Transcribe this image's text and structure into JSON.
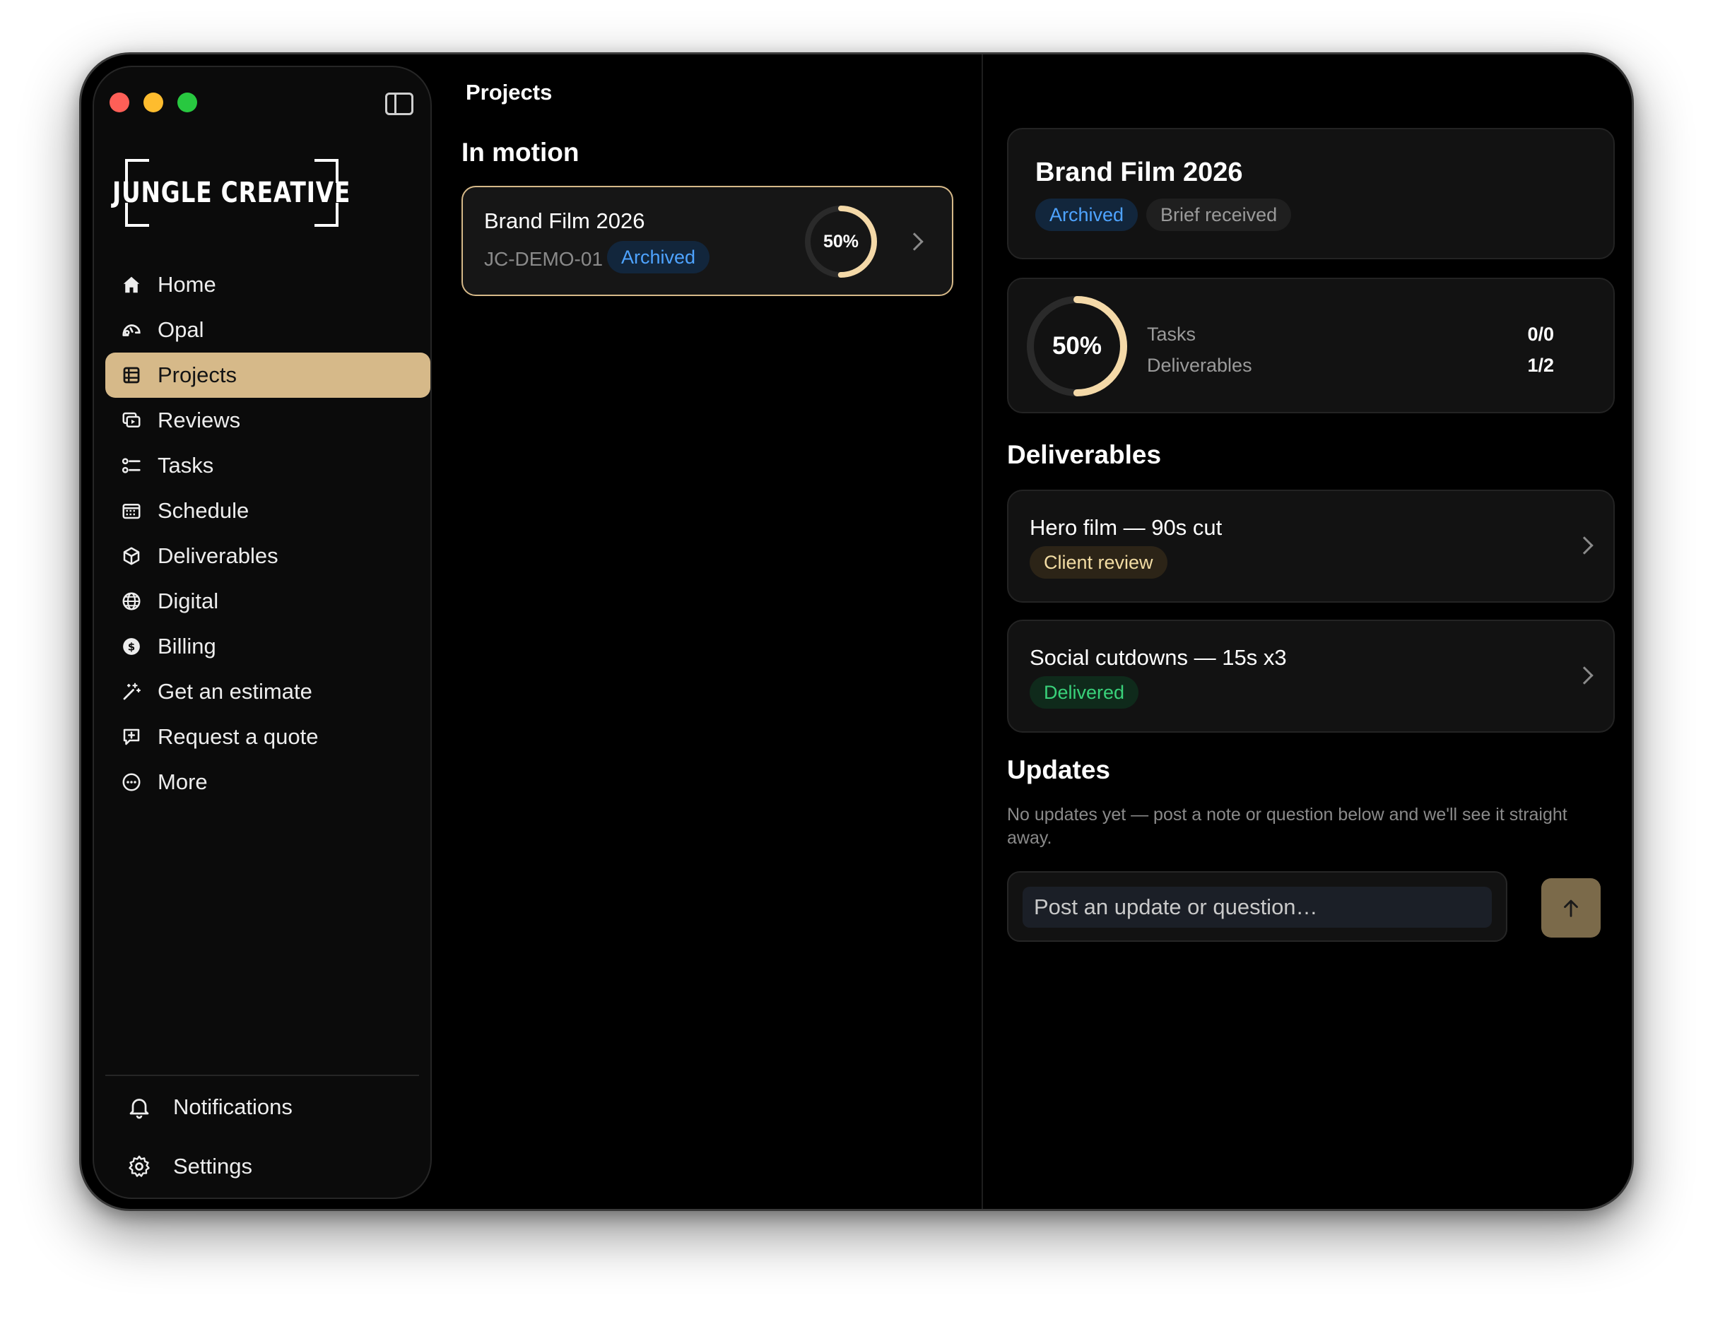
{
  "brand": {
    "logo_text": "JUNGLE CREATIVE"
  },
  "sidebar": {
    "items": [
      {
        "label": "Home",
        "icon": "home-icon"
      },
      {
        "label": "Opal",
        "icon": "opal-icon"
      },
      {
        "label": "Projects",
        "icon": "projects-icon",
        "active": true
      },
      {
        "label": "Reviews",
        "icon": "reviews-icon"
      },
      {
        "label": "Tasks",
        "icon": "tasks-icon"
      },
      {
        "label": "Schedule",
        "icon": "calendar-icon"
      },
      {
        "label": "Deliverables",
        "icon": "box-icon"
      },
      {
        "label": "Digital",
        "icon": "globe-icon"
      },
      {
        "label": "Billing",
        "icon": "dollar-icon"
      },
      {
        "label": "Get an estimate",
        "icon": "sparkle-wand-icon"
      },
      {
        "label": "Request a quote",
        "icon": "message-plus-icon"
      },
      {
        "label": "More",
        "icon": "more-icon"
      }
    ],
    "footer": [
      {
        "label": "Notifications",
        "icon": "bell-icon"
      },
      {
        "label": "Settings",
        "icon": "gear-icon"
      }
    ]
  },
  "middle": {
    "title": "Projects",
    "section": "In motion",
    "project": {
      "title": "Brand Film 2026",
      "code": "JC-DEMO-01",
      "status": "Archived",
      "progress_label": "50%",
      "progress": 0.5
    }
  },
  "detail": {
    "title": "Brand Film 2026",
    "badges": [
      "Archived",
      "Brief received"
    ],
    "progress_label": "50%",
    "progress": 0.5,
    "stats": [
      {
        "label": "Tasks",
        "value": "0/0"
      },
      {
        "label": "Deliverables",
        "value": "1/2"
      }
    ],
    "deliverables_title": "Deliverables",
    "deliverables": [
      {
        "name": "Hero film — 90s cut",
        "status": "Client review"
      },
      {
        "name": "Social cutdowns — 15s x3",
        "status": "Delivered"
      }
    ],
    "updates_title": "Updates",
    "updates_empty": "No updates yet — post a note or question below and we'll see it straight away.",
    "compose_placeholder": "Post an update or question…"
  },
  "colors": {
    "accent": "#d6b989",
    "archived": "#4ea3ff",
    "delivered": "#39d17a",
    "review": "#f2dca3",
    "ring_track": "#2a2a2a",
    "ring_fill": "#f4d9a8"
  }
}
